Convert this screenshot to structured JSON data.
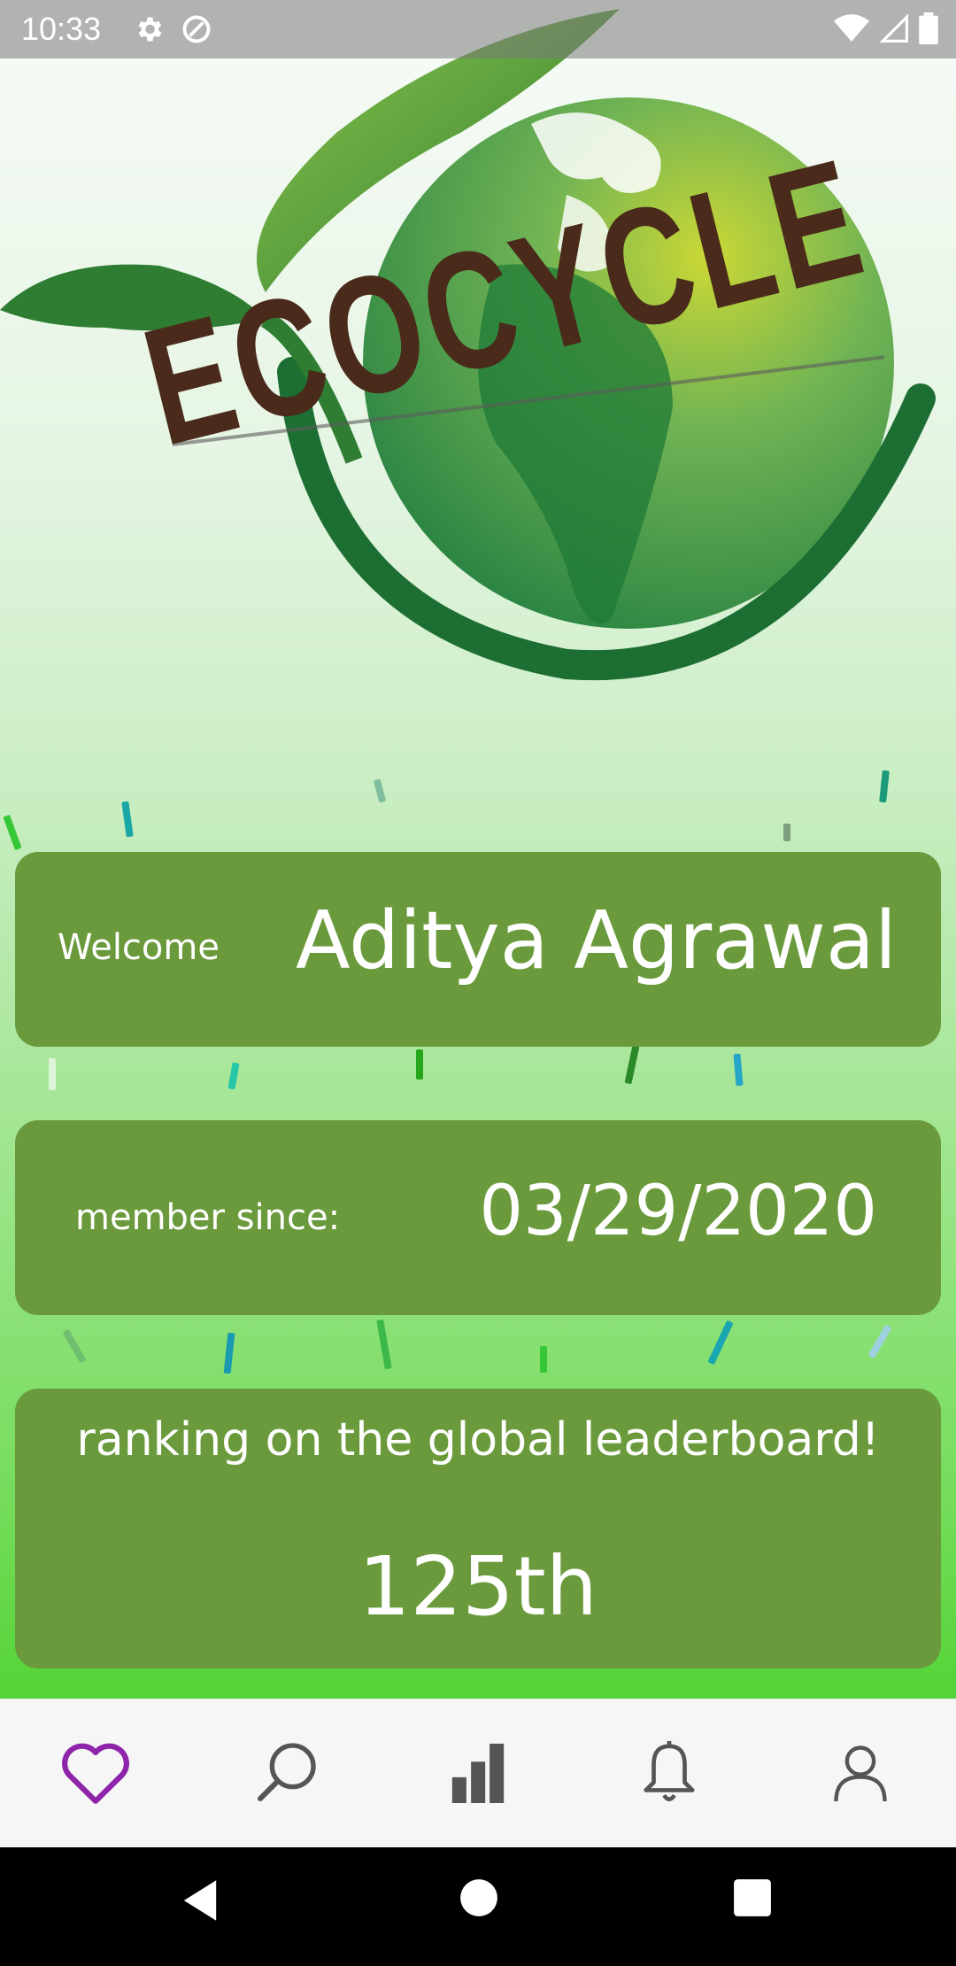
{
  "status_bar": {
    "time": "10:33"
  },
  "logo": {
    "text": "ECOCYCLE"
  },
  "welcome_card": {
    "label": "Welcome",
    "name": "Aditya Agrawal"
  },
  "member_card": {
    "label": "member since:",
    "date": "03/29/2020"
  },
  "rank_card": {
    "label": "ranking on the global leaderboard!",
    "value": "125th"
  },
  "bottom_nav": {
    "items": [
      {
        "icon": "heart-icon",
        "active": true
      },
      {
        "icon": "search-icon",
        "active": false
      },
      {
        "icon": "bar-chart-icon",
        "active": false
      },
      {
        "icon": "bell-icon",
        "active": false
      },
      {
        "icon": "person-icon",
        "active": false
      }
    ]
  },
  "colors": {
    "card": "#6a9a3c",
    "active_nav": "#8e24aa",
    "inactive_nav": "#555555"
  }
}
